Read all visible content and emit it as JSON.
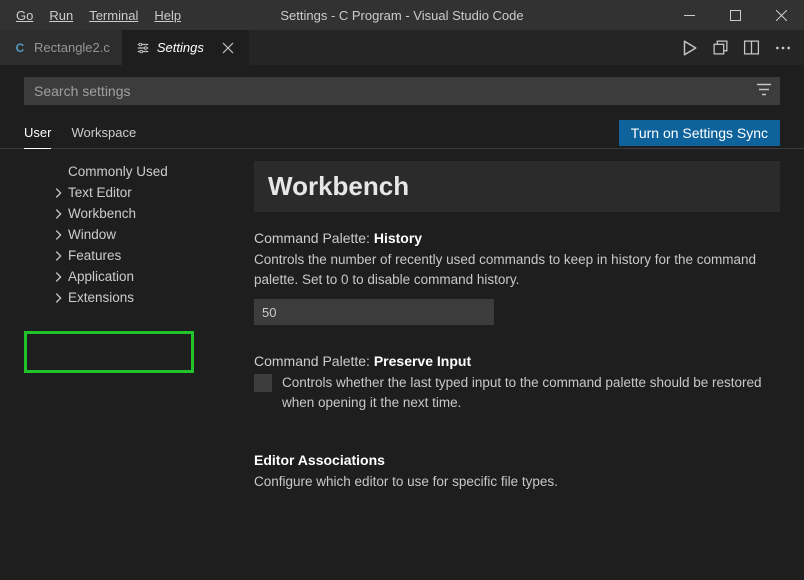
{
  "menubar": {
    "items": [
      "Go",
      "Run",
      "Terminal",
      "Help"
    ]
  },
  "window_title": "Settings - C Program - Visual Studio Code",
  "tabs": [
    {
      "label": "Rectangle2.c",
      "icon": "c-file-icon",
      "active": false
    },
    {
      "label": "Settings",
      "icon": "settings-icon",
      "active": true
    }
  ],
  "search": {
    "placeholder": "Search settings",
    "value": ""
  },
  "scopes": {
    "user": "User",
    "workspace": "Workspace"
  },
  "sync_button": "Turn on Settings Sync",
  "toc": {
    "items": [
      {
        "label": "Commonly Used",
        "expandable": false
      },
      {
        "label": "Text Editor",
        "expandable": true
      },
      {
        "label": "Workbench",
        "expandable": true
      },
      {
        "label": "Window",
        "expandable": true
      },
      {
        "label": "Features",
        "expandable": true
      },
      {
        "label": "Application",
        "expandable": true
      },
      {
        "label": "Extensions",
        "expandable": true
      }
    ]
  },
  "section_heading": "Workbench",
  "settings": {
    "history": {
      "title_prefix": "Command Palette: ",
      "title_bold": "History",
      "description": "Controls the number of recently used commands to keep in history for the command palette. Set to 0 to disable command history.",
      "value": "50"
    },
    "preserve": {
      "title_prefix": "Command Palette: ",
      "title_bold": "Preserve Input",
      "description": "Controls whether the last typed input to the command palette should be restored when opening it the next time.",
      "checked": false
    },
    "assoc": {
      "title_bold": "Editor Associations",
      "description": "Configure which editor to use for specific file types."
    }
  }
}
